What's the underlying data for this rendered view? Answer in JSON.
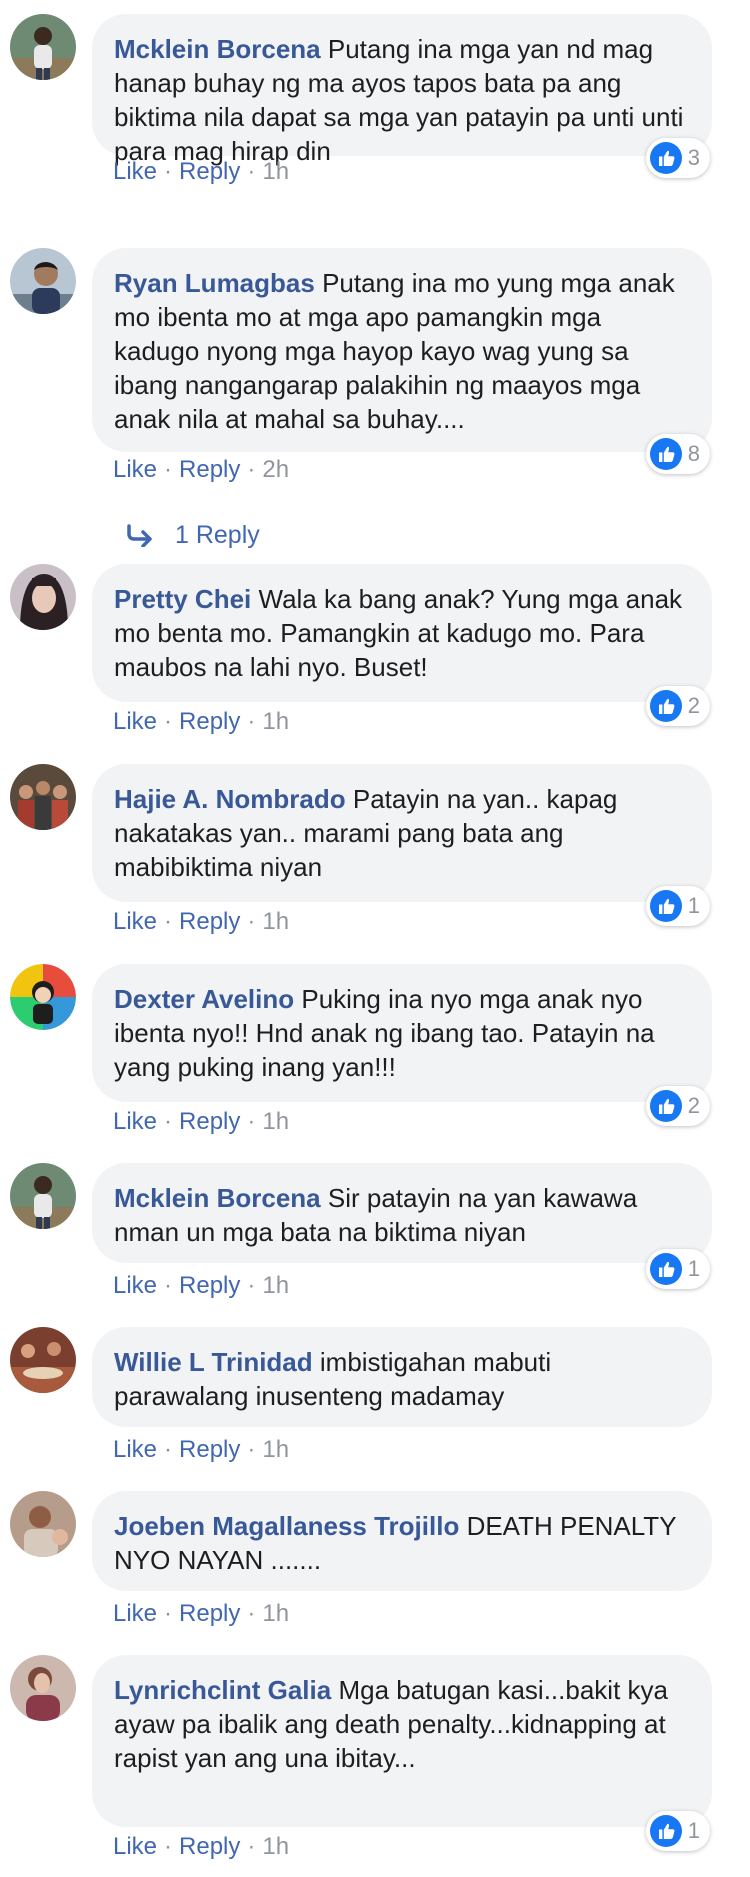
{
  "ui": {
    "like_label": "Like",
    "reply_label": "Reply",
    "separator": "·",
    "like_color": "#1877f2",
    "name_color": "#385898",
    "bubble_color": "#f2f3f5"
  },
  "comments": [
    {
      "author": "Mcklein Borcena",
      "text": "Putang ina mga yan nd mag hanap buhay ng ma ayos tapos bata pa ang biktima nila dapat sa mga yan patayin pa unti unti para mag hirap din",
      "time": "1h",
      "likes": "3",
      "avatar_icon": "person-photo"
    },
    {
      "author": "Ryan Lumagbas",
      "text": "Putang ina mo yung mga anak mo ibenta mo at mga apo pamangkin mga kadugo nyong mga hayop kayo wag yung sa ibang nangangarap palakihin ng maayos mga anak nila at mahal sa buhay....",
      "time": "2h",
      "likes": "8",
      "avatar_icon": "person-photo",
      "replies_label": "1 Reply"
    },
    {
      "author": "Pretty Chei",
      "text": "Wala ka bang anak? Yung mga anak mo benta mo. Pamangkin at kadugo mo. Para maubos na lahi nyo. Buset!",
      "time": "1h",
      "likes": "2",
      "avatar_icon": "person-photo"
    },
    {
      "author": "Hajie A. Nombrado",
      "text": "Patayin na yan.. kapag nakatakas yan.. marami pang bata ang mabibiktima niyan",
      "time": "1h",
      "likes": "1",
      "avatar_icon": "group-photo"
    },
    {
      "author": "Dexter Avelino",
      "text": "Puking ina nyo mga anak nyo ibenta nyo!! Hnd anak ng ibang tao. Patayin na yang puking inang yan!!!",
      "time": "1h",
      "likes": "2",
      "avatar_icon": "cartoon-avatar"
    },
    {
      "author": "Mcklein Borcena",
      "text": "Sir patayin na yan kawawa nman un mga bata na biktima niyan",
      "time": "1h",
      "likes": "1",
      "avatar_icon": "person-photo"
    },
    {
      "author": "Willie L Trinidad",
      "text": "imbistigahan mabuti parawalang inusenteng madamay",
      "time": "1h",
      "avatar_icon": "group-photo"
    },
    {
      "author": "Joeben Magallaness Trojillo",
      "text": "DEATH PENALTY NYO NAYAN .......",
      "time": "1h",
      "avatar_icon": "person-photo"
    },
    {
      "author": "Lynrichclint Galia",
      "text": "Mga batugan kasi...bakit kya ayaw pa ibalik ang death penalty...kidnapping at rapist yan ang una ibitay...",
      "time": "1h",
      "likes": "1",
      "avatar_icon": "person-photo"
    }
  ]
}
